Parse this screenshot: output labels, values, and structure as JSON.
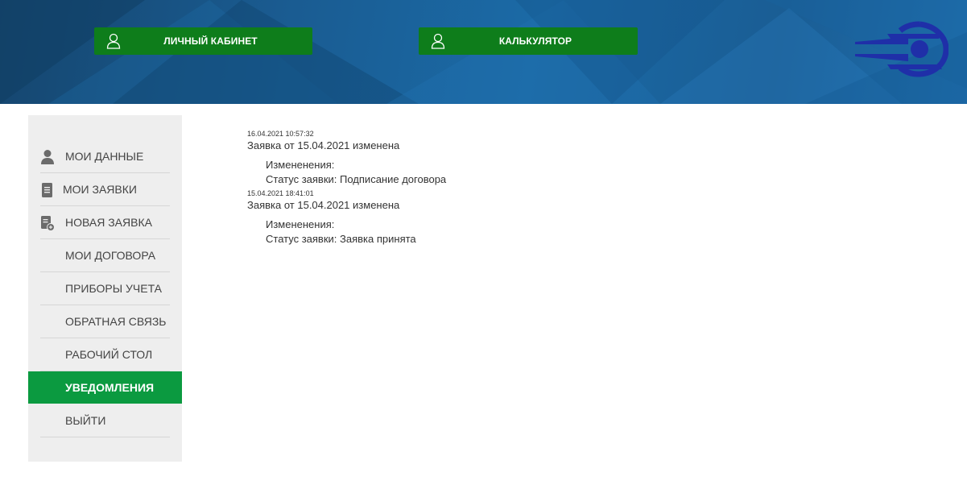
{
  "header": {
    "cabinet_button": "ЛИЧНЫЙ КАБИНЕТ",
    "calculator_button": "КАЛЬКУЛЯТОР",
    "logo_icon": "company-logo-icon"
  },
  "sidebar": {
    "items": [
      {
        "label": "МОИ ДАННЫЕ",
        "icon": "user-icon"
      },
      {
        "label": "МОИ ЗАЯВКИ",
        "icon": "document-icon"
      },
      {
        "label": "НОВАЯ ЗАЯВКА",
        "icon": "new-document-icon"
      },
      {
        "label": "МОИ ДОГОВОРА"
      },
      {
        "label": "ПРИБОРЫ УЧЕТА"
      },
      {
        "label": "ОБРАТНАЯ СВЯЗЬ"
      },
      {
        "label": "РАБОЧИЙ СТОЛ"
      },
      {
        "label": "УВЕДОМЛЕНИЯ",
        "active": true
      },
      {
        "label": "ВЫЙТИ"
      }
    ]
  },
  "notifications": [
    {
      "timestamp": "16.04.2021 10:57:32",
      "title": "Заявка от 15.04.2021 изменена",
      "changes_label": "Измененения:",
      "change": "Статус заявки: Подписание договора"
    },
    {
      "timestamp": "15.04.2021 18:41:01",
      "title": "Заявка от 15.04.2021 изменена",
      "changes_label": "Измененения:",
      "change": "Статус заявки: Заявка принята"
    }
  ],
  "colors": {
    "header_blue": "#1a5c92",
    "button_green": "#0e7d1b",
    "active_green": "#0b9a40",
    "sidebar_bg": "#eeeeee",
    "logo_blue": "#1f2fa8"
  }
}
